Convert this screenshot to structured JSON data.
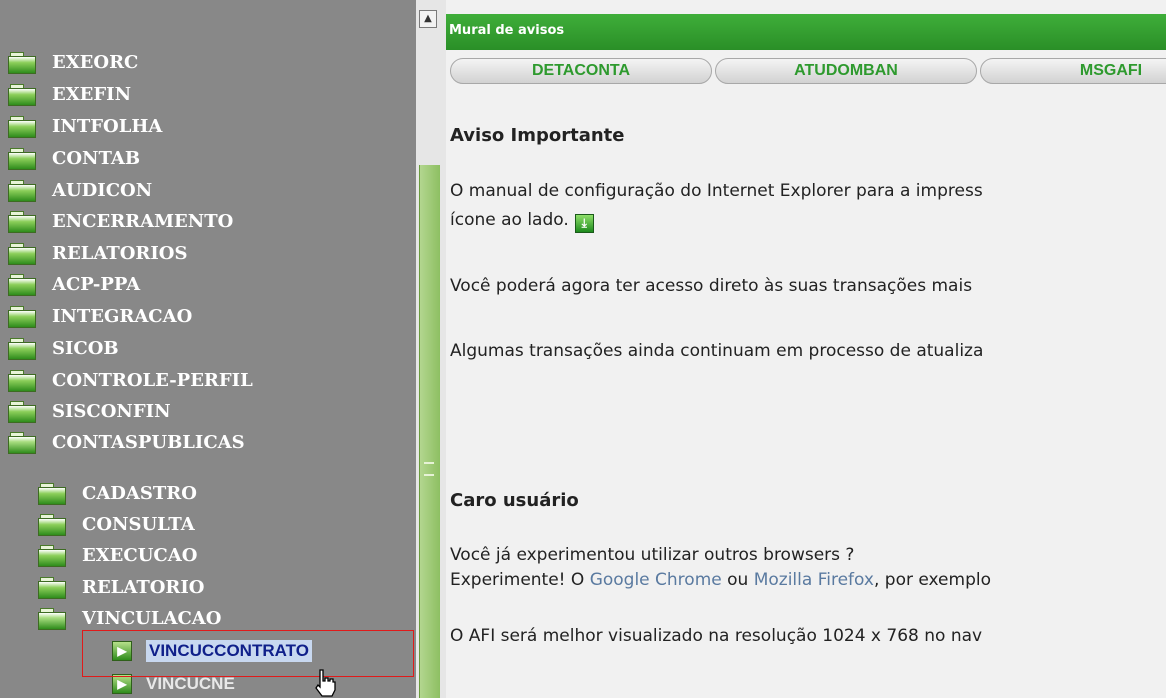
{
  "tree": {
    "folders": [
      {
        "label": "EXEORC",
        "open": false
      },
      {
        "label": "EXEFIN",
        "open": false
      },
      {
        "label": "INTFOLHA",
        "open": false
      },
      {
        "label": "CONTAB",
        "open": false
      },
      {
        "label": "AUDICON",
        "open": false
      },
      {
        "label": "ENCERRAMENTO",
        "open": false
      },
      {
        "label": "RELATORIOS",
        "open": false
      },
      {
        "label": "ACP-PPA",
        "open": false
      },
      {
        "label": "INTEGRACAO",
        "open": false
      },
      {
        "label": "SICOB",
        "open": false
      },
      {
        "label": "CONTROLE-PERFIL",
        "open": false
      },
      {
        "label": "SISCONFIN",
        "open": false
      },
      {
        "label": "CONTASPUBLICAS",
        "open": true
      }
    ],
    "subfolders": [
      {
        "label": "CADASTRO",
        "open": false
      },
      {
        "label": "CONSULTA",
        "open": false
      },
      {
        "label": "EXECUCAO",
        "open": false
      },
      {
        "label": "RELATORIO",
        "open": false
      },
      {
        "label": "VINCULACAO",
        "open": true
      }
    ],
    "leaves": [
      {
        "label": "VINCUCCONTRATO",
        "selected": true
      },
      {
        "label": "VINCUCNE",
        "selected": false
      }
    ]
  },
  "splitter": {
    "scroll_up_glyph": "▲"
  },
  "mural": {
    "title": "Mural de avisos",
    "tabs": [
      "DETACONTA",
      "ATUDOMBAN",
      "MSGAFI"
    ]
  },
  "notice": {
    "heading": "Aviso Importante",
    "line1": "O manual de configuração do Internet Explorer para a impress",
    "line2": "ícone ao lado.",
    "download_glyph": "⤓",
    "line3": "Você poderá agora ter acesso direto às suas transações mais",
    "line4": "Algumas transações ainda continuam em processo de atualiza"
  },
  "user_notice": {
    "heading": "Caro usuário",
    "line1": "Você já experimentou utilizar outros browsers ?",
    "line2_start": "Experimente! O ",
    "link_chrome": "Google Chrome",
    "line2_mid": " ou ",
    "link_firefox": "Mozilla Firefox",
    "line2_end": ", por exemplo",
    "line3": "O AFI será melhor visualizado na resolução 1024 x 768 no nav"
  },
  "colors": {
    "tree_bg": "#888888",
    "header_green": "#3fae3a",
    "tab_text_green": "#2e9a2e",
    "selection_red": "#e01a1a"
  }
}
